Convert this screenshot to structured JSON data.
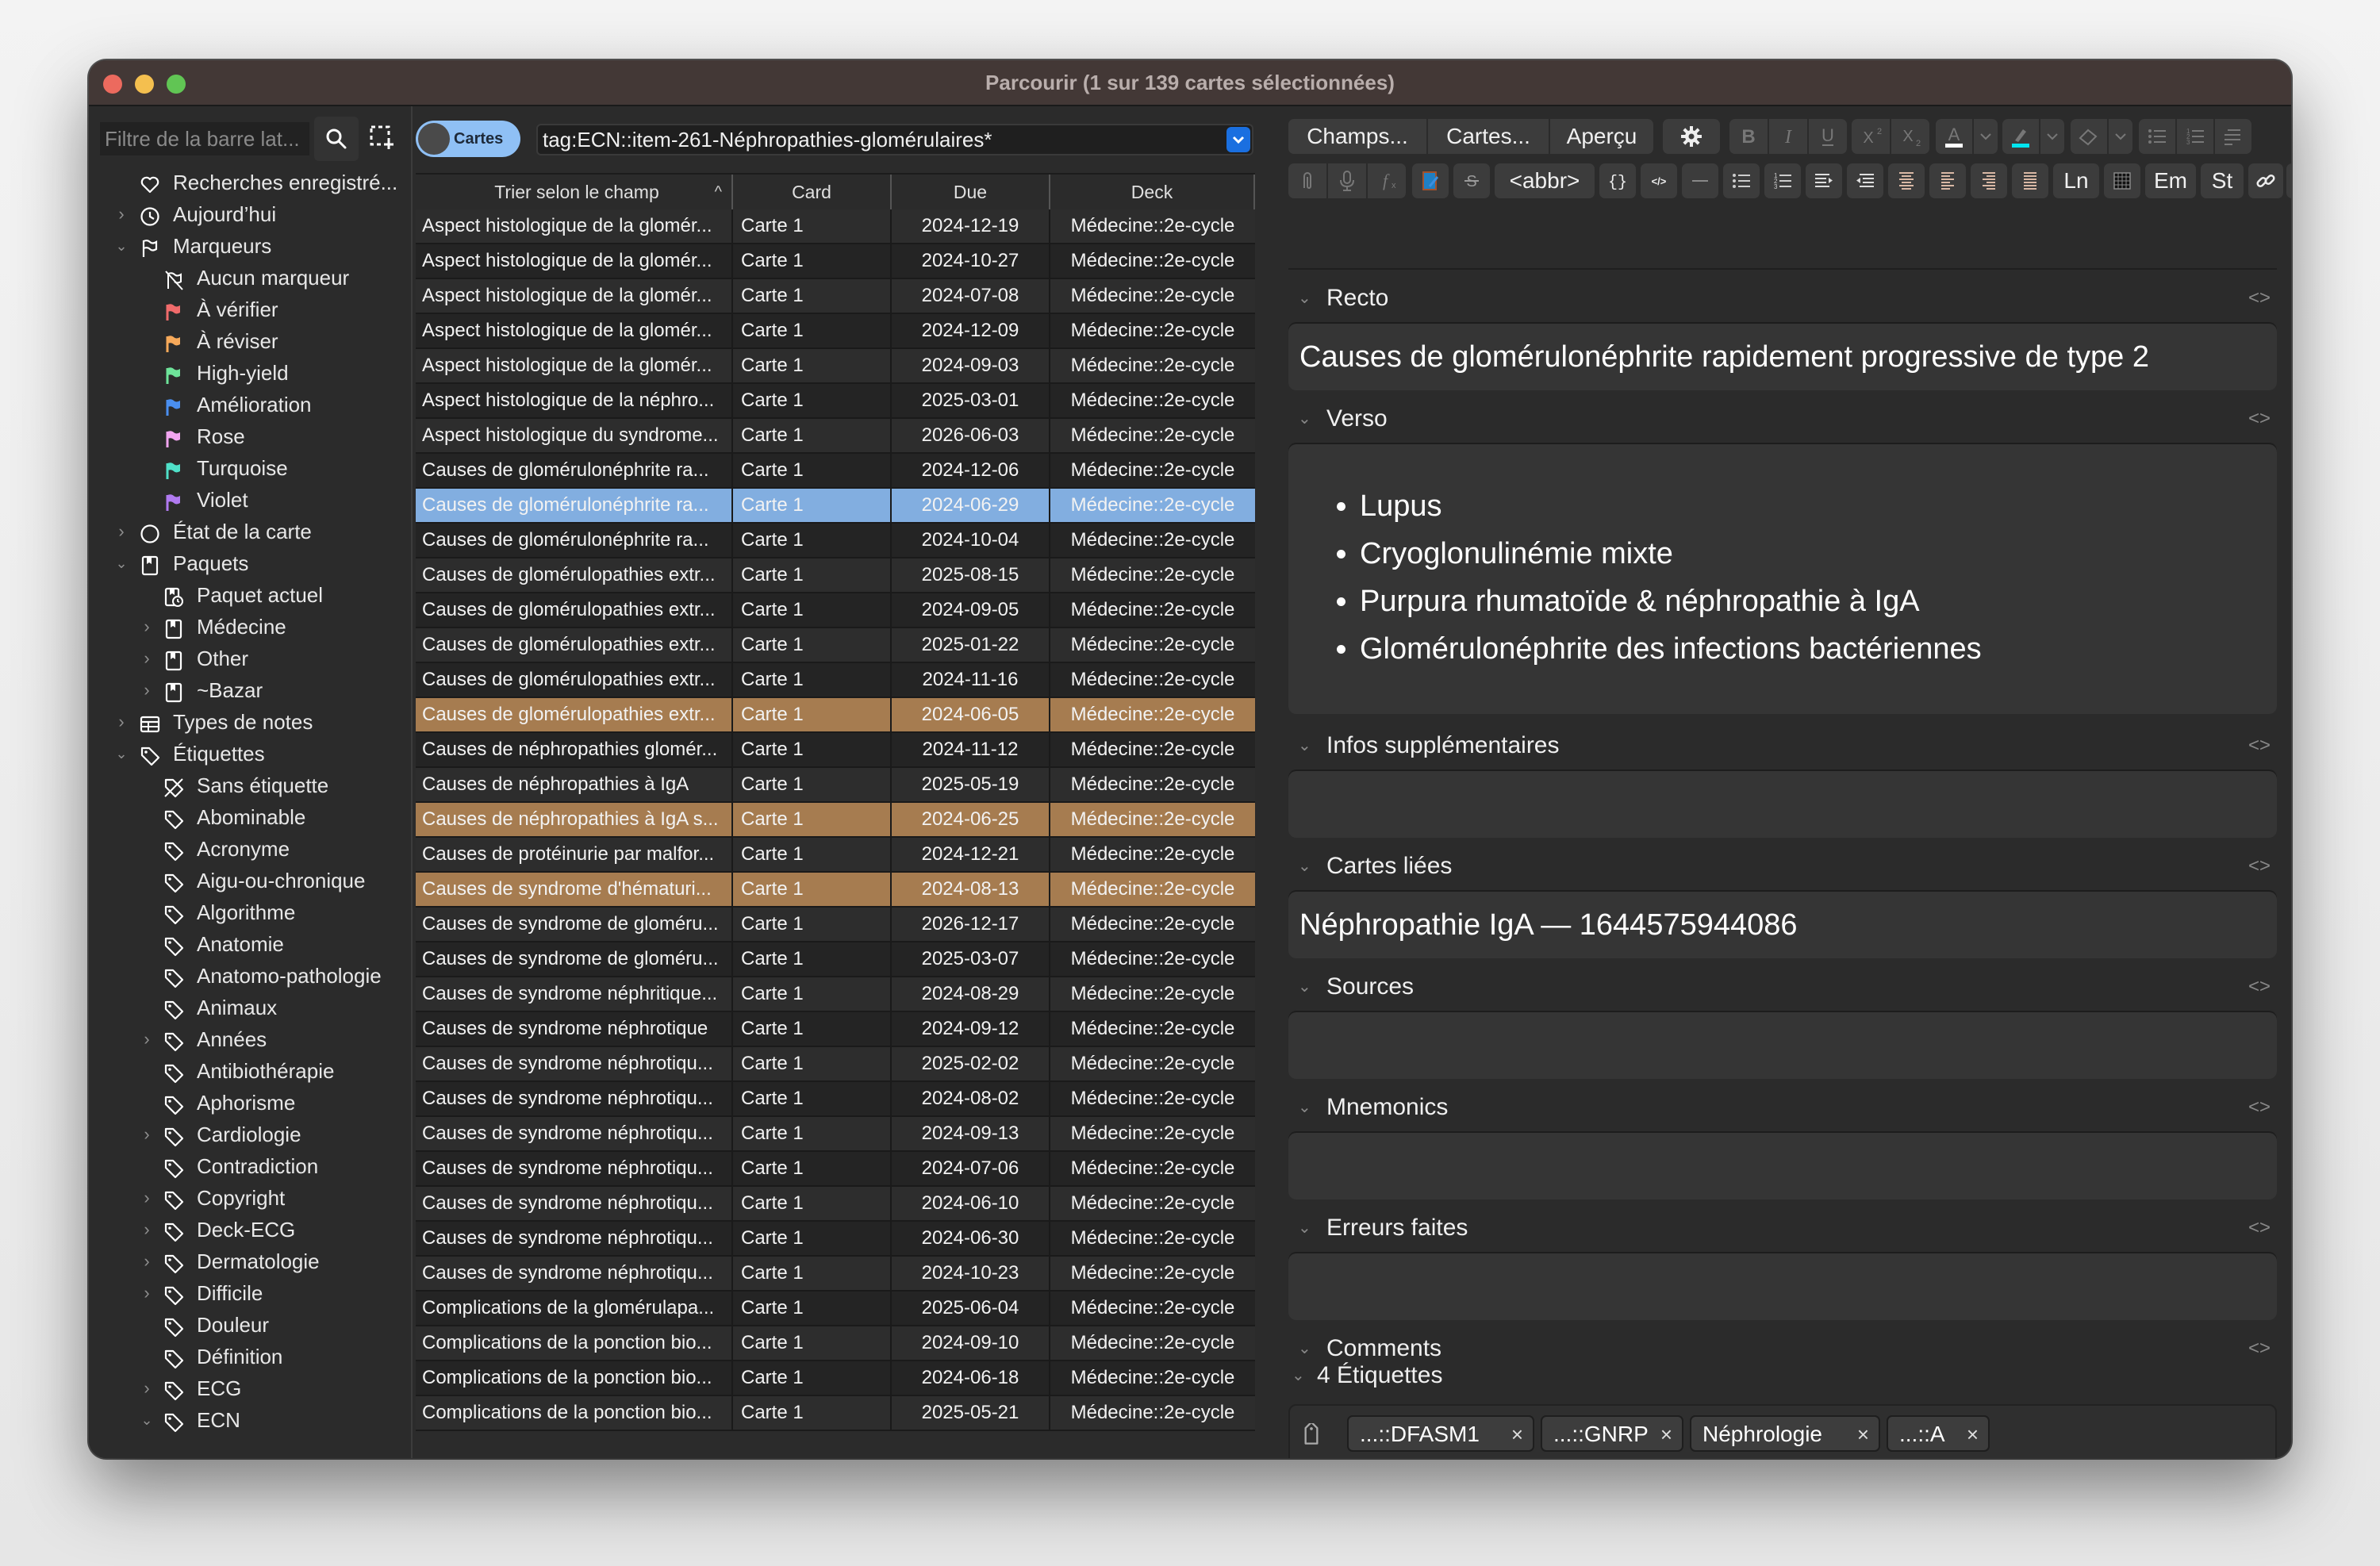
{
  "window": {
    "title": "Parcourir (1 sur 139 cartes sélectionnées)"
  },
  "sidebar": {
    "filter_placeholder": "Filtre de la barre lat...",
    "items": [
      {
        "label": "Recherches enregistré...",
        "icon": "heart-icon",
        "level": 0,
        "chevron": ""
      },
      {
        "label": "Aujourd’hui",
        "icon": "clock-icon",
        "level": 0,
        "chevron": "right"
      },
      {
        "label": "Marqueurs",
        "icon": "flag-outline-icon",
        "level": 0,
        "chevron": "down"
      },
      {
        "label": "Aucun marqueur",
        "icon": "no-flag-icon",
        "level": 1,
        "chevron": ""
      },
      {
        "label": "À vérifier",
        "icon": "flag-icon",
        "color": "#f06b6b",
        "level": 1,
        "chevron": ""
      },
      {
        "label": "À réviser",
        "icon": "flag-icon",
        "color": "#f6a95a",
        "level": 1,
        "chevron": ""
      },
      {
        "label": "High-yield",
        "icon": "flag-icon",
        "color": "#6ee49a",
        "level": 1,
        "chevron": ""
      },
      {
        "label": "Amélioration",
        "icon": "flag-icon",
        "color": "#4a8ff0",
        "level": 1,
        "chevron": ""
      },
      {
        "label": "Rose",
        "icon": "flag-icon",
        "color": "#f2a5f0",
        "level": 1,
        "chevron": ""
      },
      {
        "label": "Turquoise",
        "icon": "flag-icon",
        "color": "#4fe0c8",
        "level": 1,
        "chevron": ""
      },
      {
        "label": "Violet",
        "icon": "flag-icon",
        "color": "#b07af0",
        "level": 1,
        "chevron": ""
      },
      {
        "label": "État de la carte",
        "icon": "circle-icon",
        "level": 0,
        "chevron": "right"
      },
      {
        "label": "Paquets",
        "icon": "deck-icon",
        "level": 0,
        "chevron": "down"
      },
      {
        "label": "Paquet actuel",
        "icon": "current-deck-icon",
        "level": 1,
        "chevron": ""
      },
      {
        "label": "Médecine",
        "icon": "deck-icon",
        "level": 1,
        "chevron": "right"
      },
      {
        "label": "Other",
        "icon": "deck-icon",
        "level": 1,
        "chevron": "right"
      },
      {
        "label": "~Bazar",
        "icon": "deck-icon",
        "level": 1,
        "chevron": "right"
      },
      {
        "label": "Types de notes",
        "icon": "note-types-icon",
        "level": 0,
        "chevron": "right"
      },
      {
        "label": "Étiquettes",
        "icon": "tag-icon",
        "level": 0,
        "chevron": "down"
      },
      {
        "label": "Sans étiquette",
        "icon": "no-tag-icon",
        "level": 1,
        "chevron": ""
      },
      {
        "label": "Abominable",
        "icon": "tag-icon",
        "level": 1,
        "chevron": ""
      },
      {
        "label": "Acronyme",
        "icon": "tag-icon",
        "level": 1,
        "chevron": ""
      },
      {
        "label": "Aigu-ou-chronique",
        "icon": "tag-icon",
        "level": 1,
        "chevron": ""
      },
      {
        "label": "Algorithme",
        "icon": "tag-icon",
        "level": 1,
        "chevron": ""
      },
      {
        "label": "Anatomie",
        "icon": "tag-icon",
        "level": 1,
        "chevron": ""
      },
      {
        "label": "Anatomo-pathologie",
        "icon": "tag-icon",
        "level": 1,
        "chevron": ""
      },
      {
        "label": "Animaux",
        "icon": "tag-icon",
        "level": 1,
        "chevron": ""
      },
      {
        "label": "Années",
        "icon": "tag-icon",
        "level": 1,
        "chevron": "right"
      },
      {
        "label": "Antibiothérapie",
        "icon": "tag-icon",
        "level": 1,
        "chevron": ""
      },
      {
        "label": "Aphorisme",
        "icon": "tag-icon",
        "level": 1,
        "chevron": ""
      },
      {
        "label": "Cardiologie",
        "icon": "tag-icon",
        "level": 1,
        "chevron": "right"
      },
      {
        "label": "Contradiction",
        "icon": "tag-icon",
        "level": 1,
        "chevron": ""
      },
      {
        "label": "Copyright",
        "icon": "tag-icon",
        "level": 1,
        "chevron": "right"
      },
      {
        "label": "Deck-ECG",
        "icon": "tag-icon",
        "level": 1,
        "chevron": "right"
      },
      {
        "label": "Dermatologie",
        "icon": "tag-icon",
        "level": 1,
        "chevron": "right"
      },
      {
        "label": "Difficile",
        "icon": "tag-icon",
        "level": 1,
        "chevron": "right"
      },
      {
        "label": "Douleur",
        "icon": "tag-icon",
        "level": 1,
        "chevron": ""
      },
      {
        "label": "Définition",
        "icon": "tag-icon",
        "level": 1,
        "chevron": ""
      },
      {
        "label": "ECG",
        "icon": "tag-icon",
        "level": 1,
        "chevron": "right"
      },
      {
        "label": "ECN",
        "icon": "tag-icon",
        "level": 1,
        "chevron": "down"
      }
    ]
  },
  "browser": {
    "mode_toggle_label": "Cartes",
    "search_value": "tag:ECN::item-261-Néphropathies-glomérulaires*",
    "columns": [
      "Trier selon le champ",
      "Card",
      "Due",
      "Deck"
    ],
    "sort_indicator": "^",
    "rows": [
      {
        "field": "Aspect histologique de la glomér...",
        "card": "Carte 1",
        "due": "2024-12-19",
        "deck": "Médecine::2e-cycle",
        "state": ""
      },
      {
        "field": "Aspect histologique de la glomér...",
        "card": "Carte 1",
        "due": "2024-10-27",
        "deck": "Médecine::2e-cycle",
        "state": ""
      },
      {
        "field": "Aspect histologique de la glomér...",
        "card": "Carte 1",
        "due": "2024-07-08",
        "deck": "Médecine::2e-cycle",
        "state": ""
      },
      {
        "field": "Aspect histologique de la glomér...",
        "card": "Carte 1",
        "due": "2024-12-09",
        "deck": "Médecine::2e-cycle",
        "state": ""
      },
      {
        "field": "Aspect histologique de la glomér...",
        "card": "Carte 1",
        "due": "2024-09-03",
        "deck": "Médecine::2e-cycle",
        "state": ""
      },
      {
        "field": "Aspect histologique de la néphro...",
        "card": "Carte 1",
        "due": "2025-03-01",
        "deck": "Médecine::2e-cycle",
        "state": ""
      },
      {
        "field": "Aspect histologique du syndrome...",
        "card": "Carte 1",
        "due": "2026-06-03",
        "deck": "Médecine::2e-cycle",
        "state": ""
      },
      {
        "field": "Causes de glomérulonéphrite ra...",
        "card": "Carte 1",
        "due": "2024-12-06",
        "deck": "Médecine::2e-cycle",
        "state": ""
      },
      {
        "field": "Causes de glomérulonéphrite ra...",
        "card": "Carte 1",
        "due": "2024-06-29",
        "deck": "Médecine::2e-cycle",
        "state": "selected"
      },
      {
        "field": "Causes de glomérulonéphrite ra...",
        "card": "Carte 1",
        "due": "2024-10-04",
        "deck": "Médecine::2e-cycle",
        "state": ""
      },
      {
        "field": "Causes de glomérulopathies extr...",
        "card": "Carte 1",
        "due": "2025-08-15",
        "deck": "Médecine::2e-cycle",
        "state": ""
      },
      {
        "field": "Causes de glomérulopathies extr...",
        "card": "Carte 1",
        "due": "2024-09-05",
        "deck": "Médecine::2e-cycle",
        "state": ""
      },
      {
        "field": "Causes de glomérulopathies extr...",
        "card": "Carte 1",
        "due": "2025-01-22",
        "deck": "Médecine::2e-cycle",
        "state": ""
      },
      {
        "field": "Causes de glomérulopathies extr...",
        "card": "Carte 1",
        "due": "2024-11-16",
        "deck": "Médecine::2e-cycle",
        "state": ""
      },
      {
        "field": "Causes de glomérulopathies extr...",
        "card": "Carte 1",
        "due": "2024-06-05",
        "deck": "Médecine::2e-cycle",
        "state": "flagged"
      },
      {
        "field": "Causes de néphropathies glomér...",
        "card": "Carte 1",
        "due": "2024-11-12",
        "deck": "Médecine::2e-cycle",
        "state": ""
      },
      {
        "field": "Causes de néphropathies à IgA",
        "card": "Carte 1",
        "due": "2025-05-19",
        "deck": "Médecine::2e-cycle",
        "state": ""
      },
      {
        "field": "Causes de néphropathies à IgA s...",
        "card": "Carte 1",
        "due": "2024-06-25",
        "deck": "Médecine::2e-cycle",
        "state": "flagged"
      },
      {
        "field": "Causes de protéinurie par malfor...",
        "card": "Carte 1",
        "due": "2024-12-21",
        "deck": "Médecine::2e-cycle",
        "state": ""
      },
      {
        "field": "Causes de syndrome d'hématuri...",
        "card": "Carte 1",
        "due": "2024-08-13",
        "deck": "Médecine::2e-cycle",
        "state": "flagged"
      },
      {
        "field": "Causes de syndrome de gloméru...",
        "card": "Carte 1",
        "due": "2026-12-17",
        "deck": "Médecine::2e-cycle",
        "state": ""
      },
      {
        "field": "Causes de syndrome de gloméru...",
        "card": "Carte 1",
        "due": "2025-03-07",
        "deck": "Médecine::2e-cycle",
        "state": ""
      },
      {
        "field": "Causes de syndrome néphritique...",
        "card": "Carte 1",
        "due": "2024-08-29",
        "deck": "Médecine::2e-cycle",
        "state": ""
      },
      {
        "field": "Causes de syndrome néphrotique",
        "card": "Carte 1",
        "due": "2024-09-12",
        "deck": "Médecine::2e-cycle",
        "state": ""
      },
      {
        "field": "Causes de syndrome néphrotiqu...",
        "card": "Carte 1",
        "due": "2025-02-02",
        "deck": "Médecine::2e-cycle",
        "state": ""
      },
      {
        "field": "Causes de syndrome néphrotiqu...",
        "card": "Carte 1",
        "due": "2024-08-02",
        "deck": "Médecine::2e-cycle",
        "state": ""
      },
      {
        "field": "Causes de syndrome néphrotiqu...",
        "card": "Carte 1",
        "due": "2024-09-13",
        "deck": "Médecine::2e-cycle",
        "state": ""
      },
      {
        "field": "Causes de syndrome néphrotiqu...",
        "card": "Carte 1",
        "due": "2024-07-06",
        "deck": "Médecine::2e-cycle",
        "state": ""
      },
      {
        "field": "Causes de syndrome néphrotiqu...",
        "card": "Carte 1",
        "due": "2024-06-10",
        "deck": "Médecine::2e-cycle",
        "state": ""
      },
      {
        "field": "Causes de syndrome néphrotiqu...",
        "card": "Carte 1",
        "due": "2024-06-30",
        "deck": "Médecine::2e-cycle",
        "state": ""
      },
      {
        "field": "Causes de syndrome néphrotiqu...",
        "card": "Carte 1",
        "due": "2024-10-23",
        "deck": "Médecine::2e-cycle",
        "state": ""
      },
      {
        "field": "Complications de la glomérulapa...",
        "card": "Carte 1",
        "due": "2025-06-04",
        "deck": "Médecine::2e-cycle",
        "state": ""
      },
      {
        "field": "Complications de la ponction bio...",
        "card": "Carte 1",
        "due": "2024-09-10",
        "deck": "Médecine::2e-cycle",
        "state": ""
      },
      {
        "field": "Complications de la ponction bio...",
        "card": "Carte 1",
        "due": "2024-06-18",
        "deck": "Médecine::2e-cycle",
        "state": ""
      },
      {
        "field": "Complications de la ponction bio...",
        "card": "Carte 1",
        "due": "2025-05-21",
        "deck": "Médecine::2e-cycle",
        "state": ""
      }
    ]
  },
  "editor": {
    "toolbar": {
      "fields_button": "Champs...",
      "cards_button": "Cartes...",
      "preview_button": "Aperçu",
      "abbr_button": "<abbr>",
      "ln_button": "Ln",
      "em_button": "Em",
      "st_button": "St",
      "text_color": "#ffffff",
      "highlight_color": "#00e5f0"
    },
    "fields": [
      {
        "name": "Recto",
        "content": "Causes de glomérulonéphrite rapidement progressive de type 2"
      },
      {
        "name": "Verso",
        "items": [
          "Lupus",
          "Cryoglonulinémie mixte",
          "Purpura rhumatoïde & néphropathie à IgA",
          "Glomérulonéphrite des infections bactériennes"
        ]
      },
      {
        "name": "Infos supplémentaires",
        "content": ""
      },
      {
        "name": "Cartes liées",
        "content": "Néphropathie IgA — 1644575944086"
      },
      {
        "name": "Sources",
        "content": ""
      },
      {
        "name": "Mnemonics",
        "content": ""
      },
      {
        "name": "Erreurs faites",
        "content": ""
      },
      {
        "name": "Comments",
        "content": ""
      }
    ],
    "tags_header": "4 Étiquettes",
    "tags": [
      "...::DFASM1",
      "...::GNRP",
      "Néphrologie",
      "...::A"
    ],
    "html_toggle": "<>",
    "remove_tag": "×"
  }
}
